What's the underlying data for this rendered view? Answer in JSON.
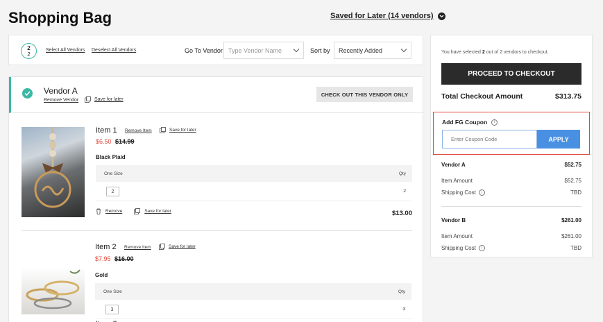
{
  "header": {
    "title": "Shopping Bag",
    "saved_for_later": "Saved for Later (14 vendors)"
  },
  "toolbar": {
    "selected_count": "2",
    "total_count": "2",
    "select_all": "Select All Vendors",
    "deselect_all": "Deselect All Vendors",
    "goto_label": "Go To Vendor",
    "vendor_placeholder": "Type Vendor Name",
    "sort_label": "Sort by",
    "sort_value": "Recently Added"
  },
  "vendor": {
    "name": "Vendor A",
    "remove_label": "Remove Vendor",
    "save_label": "Save for later",
    "checkout_label": "CHECK OUT THIS VENDOR ONLY",
    "items": [
      {
        "name": "Item 1",
        "remove_label": "Remove Item",
        "save_label": "Save for later",
        "sale_price": "$6.50",
        "original_price": "$14.99",
        "variant": "Black Plaid",
        "option_label": "One Size",
        "qty_label": "Qty",
        "qty_value": "2",
        "qty_total": "2",
        "action_remove": "Remove",
        "action_save": "Save for later",
        "total": "$13.00"
      },
      {
        "name": "Item 2",
        "remove_label": "Remove Item",
        "save_label": "Save for later",
        "sale_price": "$7.95",
        "original_price": "$16.00",
        "variant": "Gold",
        "option_label": "One Size",
        "qty_label": "Qty",
        "qty_value": "3",
        "qty_total": "3"
      }
    ]
  },
  "summary": {
    "selected_text_pre": "You have selected ",
    "selected_num": "2",
    "selected_text_post": " out of 2 vendors to checkout.",
    "checkout_button": "PROCEED TO CHECKOUT",
    "total_label": "Total Checkout Amount",
    "total_value": "$313.75",
    "coupon_label": "Add FG Coupon",
    "coupon_placeholder": "Enter Coupon Code",
    "apply_label": "APPLY",
    "vendors": [
      {
        "name": "Vendor A",
        "amount": "$52.75",
        "item_label": "Item Amount",
        "item_amount": "$52.75",
        "shipping_label": "Shipping Cost",
        "shipping_value": "TBD"
      },
      {
        "name": "Vendor B",
        "amount": "$261.00",
        "item_label": "Item Amount",
        "item_amount": "$261.00",
        "shipping_label": "Shipping Cost",
        "shipping_value": "TBD"
      }
    ]
  },
  "colors": {
    "accent_teal": "#3cb7a4",
    "sale_red": "#e2473b",
    "apply_blue": "#4a90e2",
    "checkout_dark": "#2b2b2b"
  }
}
